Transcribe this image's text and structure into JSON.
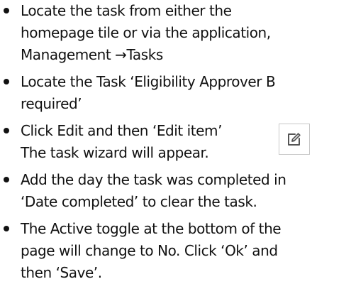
{
  "steps": [
    {
      "lines": [
        "Locate the task from either the",
        "homepage tile or via the application,",
        "Management →Tasks"
      ]
    },
    {
      "lines": [
        "Locate the Task ‘Eligibility Approver B",
        "required’"
      ]
    },
    {
      "lines": [
        "Click Edit and then ‘Edit item’",
        "The task wizard will appear."
      ],
      "icon": "edit-icon"
    },
    {
      "lines": [
        "Add the day the task was completed in",
        "‘Date completed’ to clear the task."
      ]
    },
    {
      "lines": [
        "The Active toggle at the bottom of the",
        "page will change to No. Click ‘Ok’ and",
        "then ‘Save’."
      ]
    }
  ],
  "colors": {
    "text": "#111111",
    "icon_border": "#c8c8c8",
    "icon_stroke": "#555555"
  }
}
